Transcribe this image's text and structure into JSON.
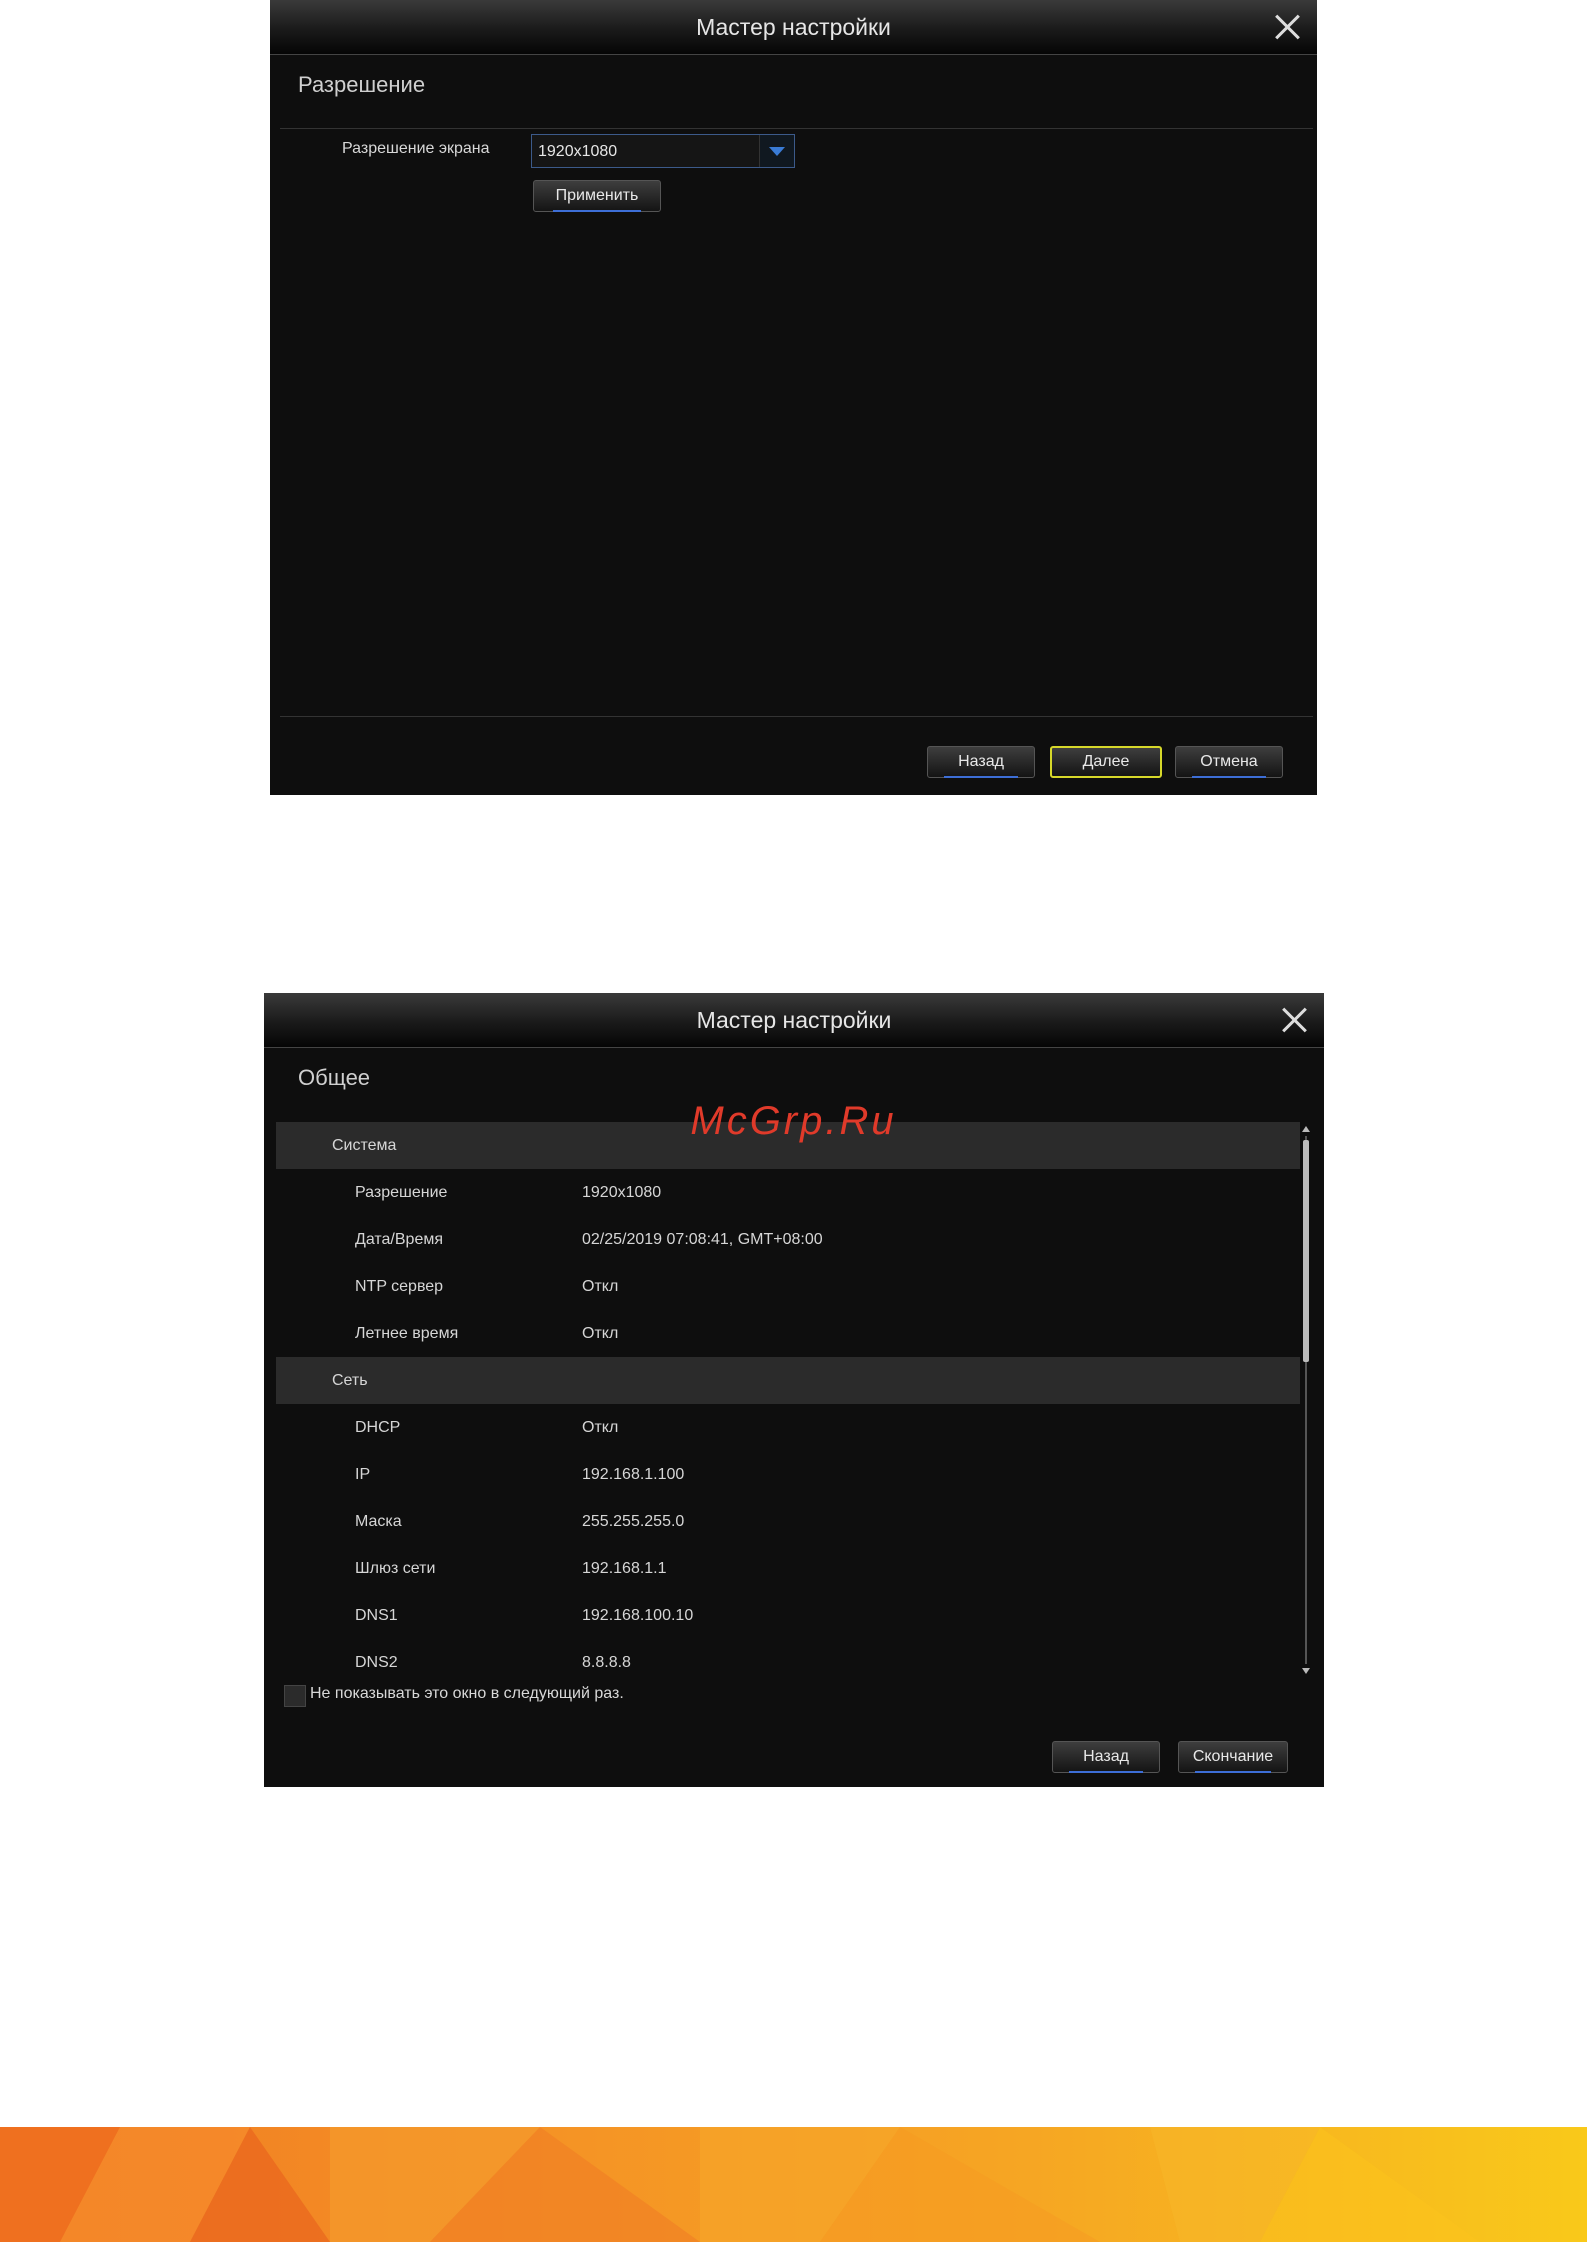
{
  "wizard1": {
    "title": "Мастер настройки",
    "section": "Разрешение",
    "resolution_label": "Разрешение экрана",
    "resolution_value": "1920x1080",
    "apply_label": "Применить",
    "buttons": {
      "back": "Назад",
      "next": "Далее",
      "cancel": "Отмена"
    }
  },
  "wizard2": {
    "title": "Мастер настройки",
    "section": "Общее",
    "groups": [
      {
        "title": "Система",
        "rows": [
          {
            "key": "Разрешение",
            "value": "1920x1080"
          },
          {
            "key": "Дата/Время",
            "value": "02/25/2019 07:08:41, GMT+08:00"
          },
          {
            "key": "NTP сервер",
            "value": "Откл"
          },
          {
            "key": "Летнее время",
            "value": "Откл"
          }
        ]
      },
      {
        "title": "Сеть",
        "rows": [
          {
            "key": "DHCP",
            "value": "Откл"
          },
          {
            "key": "IP",
            "value": "192.168.1.100"
          },
          {
            "key": "Маска",
            "value": "255.255.255.0"
          },
          {
            "key": "Шлюз сети",
            "value": "192.168.1.1"
          },
          {
            "key": "DNS1",
            "value": "192.168.100.10"
          },
          {
            "key": "DNS2",
            "value": "8.8.8.8"
          }
        ]
      }
    ],
    "dont_show_label": "Не показывать это окно в следующий раз.",
    "buttons": {
      "back": "Назад",
      "finish": "Скончание"
    }
  },
  "watermark": "McGrp.Ru",
  "colors": {
    "accent_blue": "#3a7bd5",
    "highlight_yellow": "#d6d82a",
    "watermark_red": "#e03a2a"
  }
}
